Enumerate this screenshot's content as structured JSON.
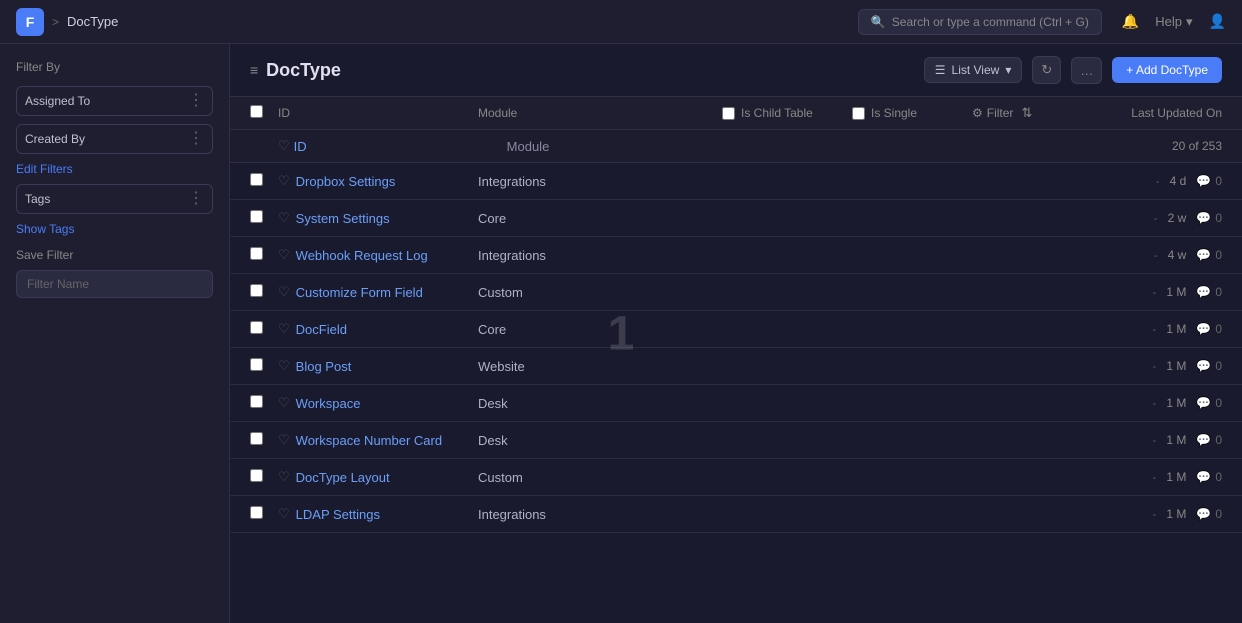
{
  "nav": {
    "logo_letter": "F",
    "breadcrumb_sep": ">",
    "page_name": "DocType",
    "search_placeholder": "Search or type a command (Ctrl + G)",
    "help_label": "Help",
    "help_chevron": "▾"
  },
  "sidebar": {
    "filter_by_label": "Filter By",
    "filters": [
      {
        "label": "Assigned To"
      },
      {
        "label": "Created By"
      },
      {
        "label": "Tags"
      }
    ],
    "edit_filters_link": "Edit Filters",
    "show_tags_link": "Show Tags",
    "save_filter_label": "Save Filter",
    "filter_name_placeholder": "Filter Name"
  },
  "header": {
    "hamburger": "≡",
    "title": "DocType",
    "view_label": "List View",
    "refresh_icon": "↻",
    "more_icon": "…",
    "add_btn_label": "+ Add DocType"
  },
  "table": {
    "col_id": "ID",
    "col_module": "Module",
    "col_child_table": "Is Child Table",
    "col_single": "Is Single",
    "col_filter": "Filter",
    "col_last_updated": "Last Updated On",
    "id_row_module": "Module",
    "count_label": "20 of 253",
    "rows": [
      {
        "id": "Dropbox Settings",
        "module": "Integrations",
        "time": "4 d",
        "comments": "0"
      },
      {
        "id": "System Settings",
        "module": "Core",
        "time": "2 w",
        "comments": "0"
      },
      {
        "id": "Webhook Request Log",
        "module": "Integrations",
        "time": "4 w",
        "comments": "0"
      },
      {
        "id": "Customize Form Field",
        "module": "Custom",
        "time": "1 M",
        "comments": "0"
      },
      {
        "id": "DocField",
        "module": "Core",
        "time": "1 M",
        "comments": "0"
      },
      {
        "id": "Blog Post",
        "module": "Website",
        "time": "1 M",
        "comments": "0"
      },
      {
        "id": "Workspace",
        "module": "Desk",
        "time": "1 M",
        "comments": "0"
      },
      {
        "id": "Workspace Number Card",
        "module": "Desk",
        "time": "1 M",
        "comments": "0"
      },
      {
        "id": "DocType Layout",
        "module": "Custom",
        "time": "1 M",
        "comments": "0"
      },
      {
        "id": "LDAP Settings",
        "module": "Integrations",
        "time": "1 M",
        "comments": "0"
      }
    ]
  },
  "overlay": {
    "number": "1"
  }
}
